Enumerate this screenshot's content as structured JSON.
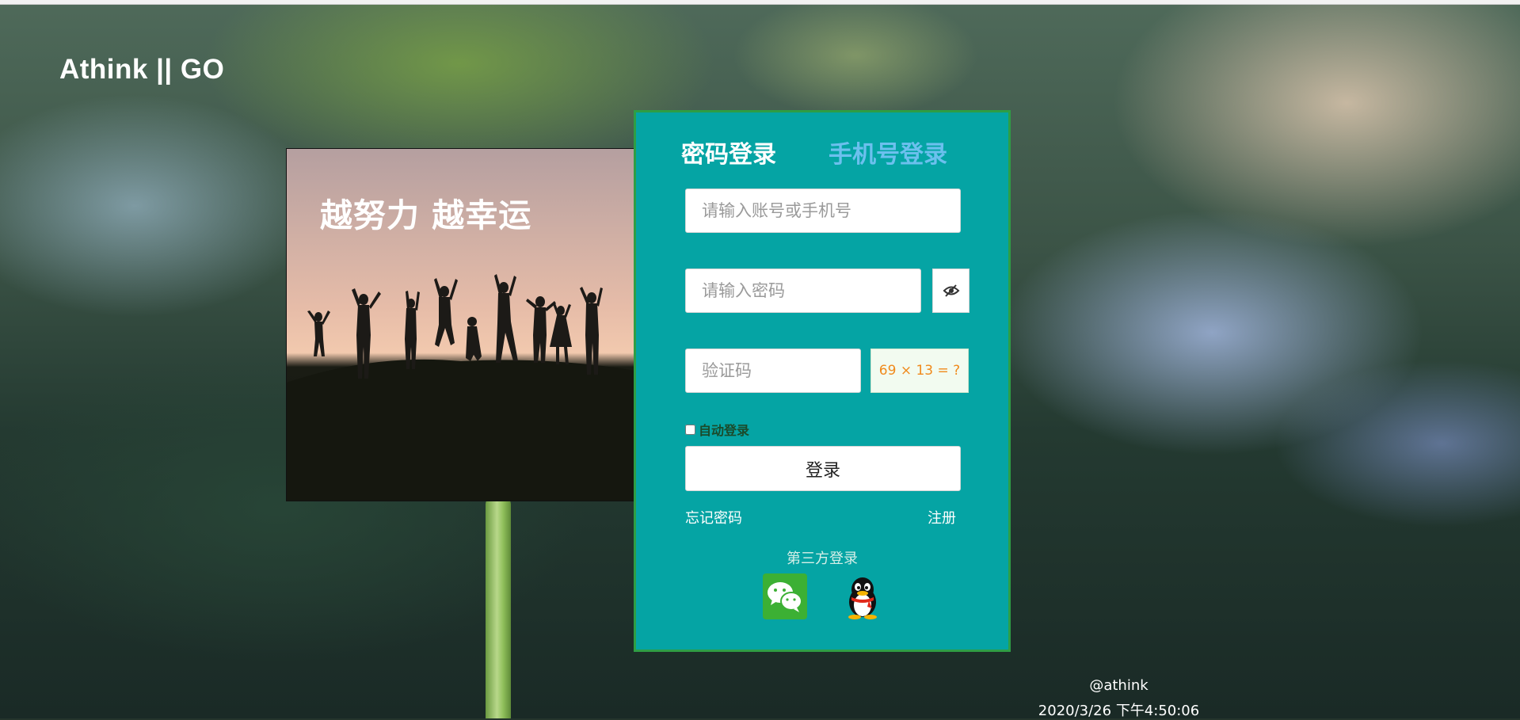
{
  "brand": {
    "logo_text": "Athink || GO"
  },
  "promo": {
    "slogan": "越努力 越幸运"
  },
  "login": {
    "tabs": [
      {
        "label": "密码登录",
        "active": true
      },
      {
        "label": "手机号登录",
        "active": false
      }
    ],
    "account_placeholder": "请输入账号或手机号",
    "password_placeholder": "请输入密码",
    "password_toggle_icon": "eye-slash-icon",
    "captcha_placeholder": "验证码",
    "captcha_question": "69 × 13 = ?",
    "remember_label": "自动登录",
    "remember_checked": false,
    "submit_label": "登录",
    "forgot_label": "忘记密码",
    "register_label": "注册",
    "third_party_label": "第三方登录",
    "third_party_icons": [
      "wechat-icon",
      "qq-icon"
    ]
  },
  "footer": {
    "handle": "@athink",
    "timestamp": "2020/3/26 下午4:50:06"
  },
  "colors": {
    "panel_bg": "#05a4a4",
    "panel_border": "#2e9e45",
    "inactive_tab": "#6cc0ee",
    "captcha_text": "#f08a1c"
  }
}
